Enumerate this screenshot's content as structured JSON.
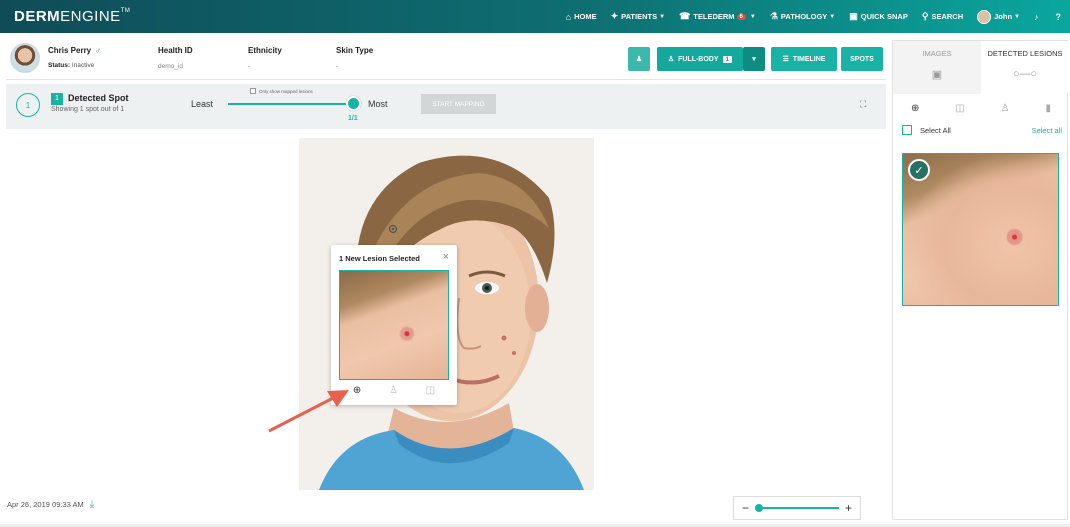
{
  "brand": {
    "bold": "DERM",
    "light": "ENGINE",
    "tm": "TM"
  },
  "nav": {
    "home": "HOME",
    "patients": "PATIENTS",
    "telederm": "TELEDERM",
    "telederm_badge": "6",
    "pathology": "PATHOLOGY",
    "quick_snap": "QUICK SNAP",
    "search": "SEARCH",
    "user": "John"
  },
  "patient": {
    "name": "Chris Perry",
    "status_label": "Status:",
    "status_value": "Inactive",
    "health_id_label": "Health ID",
    "health_id_value": "demo_id",
    "ethnicity_label": "Ethnicity",
    "ethnicity_value": "-",
    "skin_type_label": "Skin Type",
    "skin_type_value": "-"
  },
  "toolbar": {
    "full_body": "FULL-BODY",
    "full_body_count": "1",
    "timeline": "TIMELINE",
    "spots": "SPOTS"
  },
  "detect": {
    "circle_count": "1",
    "badge_count": "1",
    "title": "Detected Spot",
    "subtitle": "Showing 1 spot out of 1",
    "only_mapped": "Only show mapped lesions",
    "least": "Least",
    "most": "Most",
    "slider_value": "1/1",
    "slider_level": 1.0,
    "start_mapping": "START MAPPING"
  },
  "right_panel": {
    "tab_images": "IMAGES",
    "tab_detected": "DETECTED LESIONS",
    "select_all": "Select All",
    "select_all_link": "Select all"
  },
  "popup": {
    "title": "1 New Lesion Selected",
    "close": "×"
  },
  "footer": {
    "date": "Apr 26, 2019 09:33 AM",
    "zoom_minus": "−",
    "zoom_plus": "+",
    "zoom_level": 0.0
  },
  "icons": {
    "home": "home-icon",
    "patients": "patients-icon",
    "telederm": "telederm-icon",
    "pathology": "microscope-icon",
    "quick_snap": "camera-icon",
    "search": "search-icon",
    "notification": "bell-icon",
    "help": "help-icon"
  },
  "colors": {
    "accent": "#19b3a6",
    "nav_dark": "#0f4c58",
    "alert": "#e74c3c"
  }
}
